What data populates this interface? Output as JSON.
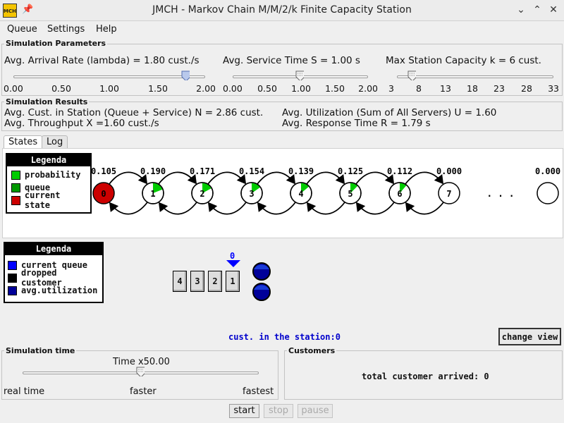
{
  "window": {
    "app_icon": "MCH",
    "title": "JMCH - Markov Chain M/M/2/k Finite Capacity Station",
    "pin_icon": "pin-icon",
    "min_icon": "chevron-down-icon",
    "max_icon": "chevron-up-icon",
    "close_icon": "close-icon"
  },
  "menu": [
    "Queue",
    "Settings",
    "Help"
  ],
  "sim_params": {
    "title": "Simulation Parameters",
    "lambda": {
      "label": "Avg. Arrival Rate (lambda) = 1.80 cust./s",
      "ticks": [
        "0.00",
        "0.50",
        "1.00",
        "1.50",
        "2.00"
      ],
      "value_fraction": 0.9
    },
    "service": {
      "label": "Avg. Service Time S = 1.00 s",
      "ticks": [
        "0.00",
        "0.50",
        "1.00",
        "1.50",
        "2.00"
      ],
      "value_fraction": 0.5
    },
    "capacity": {
      "label": "Max Station Capacity k = 6 cust.",
      "ticks": [
        "3",
        "8",
        "13",
        "18",
        "23",
        "28",
        "33"
      ],
      "value_fraction": 0.1
    }
  },
  "sim_results": {
    "title": "Simulation Results",
    "n": "Avg. Cust. in Station (Queue + Service) N = 2.86 cust.",
    "x": "Avg. Throughput X =1.60 cust./s",
    "u": "Avg. Utilization (Sum of All Servers) U = 1.60",
    "r": "Avg. Response Time R = 1.79 s"
  },
  "tabs": [
    "States",
    "Log"
  ],
  "states_legend": {
    "title": "Legenda",
    "items": [
      {
        "label": "probability",
        "color": "#00cc00"
      },
      {
        "label": "queue",
        "color": "#009900"
      },
      {
        "label": "current state",
        "color": "#cc0000"
      }
    ]
  },
  "states": [
    {
      "label": "0",
      "prob": "0.105",
      "fill": 0.0,
      "current": true
    },
    {
      "label": "1",
      "prob": "0.190",
      "fill": 0.19
    },
    {
      "label": "2",
      "prob": "0.171",
      "fill": 0.171
    },
    {
      "label": "3",
      "prob": "0.154",
      "fill": 0.154
    },
    {
      "label": "4",
      "prob": "0.139",
      "fill": 0.139
    },
    {
      "label": "5",
      "prob": "0.125",
      "fill": 0.125
    },
    {
      "label": "6",
      "prob": "0.112",
      "fill": 0.112
    },
    {
      "label": "7",
      "prob": "0.000",
      "fill": 0.0
    }
  ],
  "last_state": {
    "label": "",
    "prob": "0.000"
  },
  "ellipsis": ". . .",
  "anim_legend": {
    "title": "Legenda",
    "items": [
      {
        "label": "current queue",
        "color": "#0000ff"
      },
      {
        "label": "dropped customer",
        "color": "#000000"
      },
      {
        "label": "avg.utilization",
        "color": "#000099"
      }
    ]
  },
  "queue": {
    "slots": [
      "4",
      "3",
      "2",
      "1"
    ],
    "pointer_label": "0",
    "cust_in_station": "cust. in the station:0"
  },
  "change_view": "change view",
  "sim_time": {
    "title": "Simulation time",
    "label": "Time x50.00",
    "left": "real time",
    "mid": "faster",
    "right": "fastest",
    "value_fraction": 0.5
  },
  "customers": {
    "title": "Customers",
    "text": "total customer arrived: 0"
  },
  "controls": {
    "start": "start",
    "stop": "stop",
    "pause": "pause"
  }
}
